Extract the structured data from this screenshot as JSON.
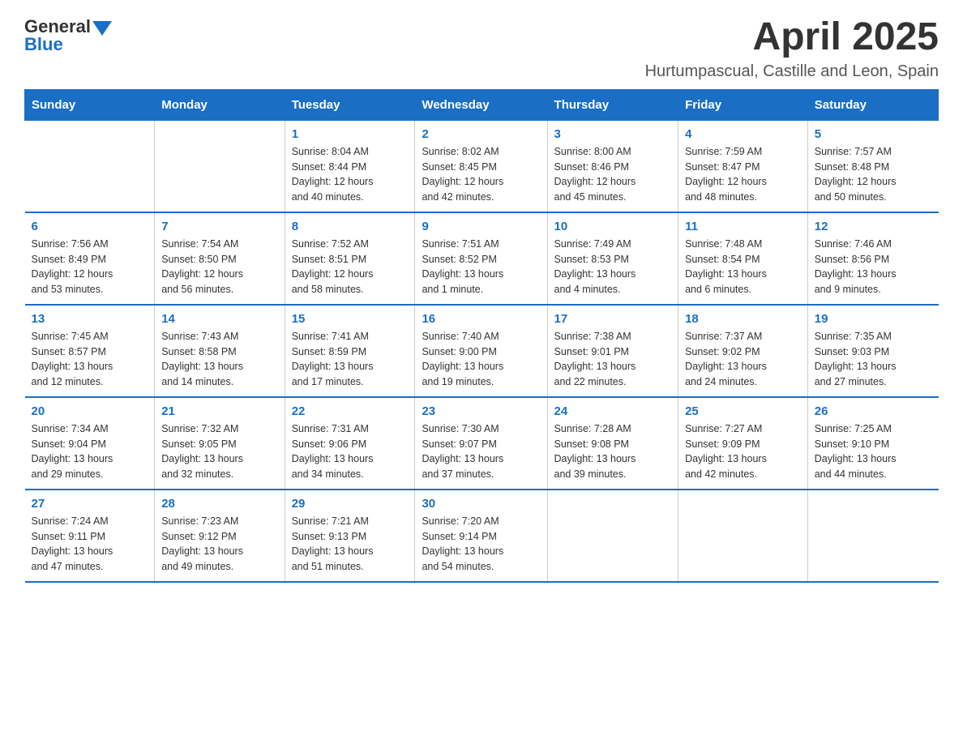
{
  "logo": {
    "text_general": "General",
    "text_blue": "Blue"
  },
  "header": {
    "month_year": "April 2025",
    "location": "Hurtumpascual, Castille and Leon, Spain"
  },
  "days_of_week": [
    "Sunday",
    "Monday",
    "Tuesday",
    "Wednesday",
    "Thursday",
    "Friday",
    "Saturday"
  ],
  "weeks": [
    [
      {
        "day": "",
        "info": ""
      },
      {
        "day": "",
        "info": ""
      },
      {
        "day": "1",
        "info": "Sunrise: 8:04 AM\nSunset: 8:44 PM\nDaylight: 12 hours\nand 40 minutes."
      },
      {
        "day": "2",
        "info": "Sunrise: 8:02 AM\nSunset: 8:45 PM\nDaylight: 12 hours\nand 42 minutes."
      },
      {
        "day": "3",
        "info": "Sunrise: 8:00 AM\nSunset: 8:46 PM\nDaylight: 12 hours\nand 45 minutes."
      },
      {
        "day": "4",
        "info": "Sunrise: 7:59 AM\nSunset: 8:47 PM\nDaylight: 12 hours\nand 48 minutes."
      },
      {
        "day": "5",
        "info": "Sunrise: 7:57 AM\nSunset: 8:48 PM\nDaylight: 12 hours\nand 50 minutes."
      }
    ],
    [
      {
        "day": "6",
        "info": "Sunrise: 7:56 AM\nSunset: 8:49 PM\nDaylight: 12 hours\nand 53 minutes."
      },
      {
        "day": "7",
        "info": "Sunrise: 7:54 AM\nSunset: 8:50 PM\nDaylight: 12 hours\nand 56 minutes."
      },
      {
        "day": "8",
        "info": "Sunrise: 7:52 AM\nSunset: 8:51 PM\nDaylight: 12 hours\nand 58 minutes."
      },
      {
        "day": "9",
        "info": "Sunrise: 7:51 AM\nSunset: 8:52 PM\nDaylight: 13 hours\nand 1 minute."
      },
      {
        "day": "10",
        "info": "Sunrise: 7:49 AM\nSunset: 8:53 PM\nDaylight: 13 hours\nand 4 minutes."
      },
      {
        "day": "11",
        "info": "Sunrise: 7:48 AM\nSunset: 8:54 PM\nDaylight: 13 hours\nand 6 minutes."
      },
      {
        "day": "12",
        "info": "Sunrise: 7:46 AM\nSunset: 8:56 PM\nDaylight: 13 hours\nand 9 minutes."
      }
    ],
    [
      {
        "day": "13",
        "info": "Sunrise: 7:45 AM\nSunset: 8:57 PM\nDaylight: 13 hours\nand 12 minutes."
      },
      {
        "day": "14",
        "info": "Sunrise: 7:43 AM\nSunset: 8:58 PM\nDaylight: 13 hours\nand 14 minutes."
      },
      {
        "day": "15",
        "info": "Sunrise: 7:41 AM\nSunset: 8:59 PM\nDaylight: 13 hours\nand 17 minutes."
      },
      {
        "day": "16",
        "info": "Sunrise: 7:40 AM\nSunset: 9:00 PM\nDaylight: 13 hours\nand 19 minutes."
      },
      {
        "day": "17",
        "info": "Sunrise: 7:38 AM\nSunset: 9:01 PM\nDaylight: 13 hours\nand 22 minutes."
      },
      {
        "day": "18",
        "info": "Sunrise: 7:37 AM\nSunset: 9:02 PM\nDaylight: 13 hours\nand 24 minutes."
      },
      {
        "day": "19",
        "info": "Sunrise: 7:35 AM\nSunset: 9:03 PM\nDaylight: 13 hours\nand 27 minutes."
      }
    ],
    [
      {
        "day": "20",
        "info": "Sunrise: 7:34 AM\nSunset: 9:04 PM\nDaylight: 13 hours\nand 29 minutes."
      },
      {
        "day": "21",
        "info": "Sunrise: 7:32 AM\nSunset: 9:05 PM\nDaylight: 13 hours\nand 32 minutes."
      },
      {
        "day": "22",
        "info": "Sunrise: 7:31 AM\nSunset: 9:06 PM\nDaylight: 13 hours\nand 34 minutes."
      },
      {
        "day": "23",
        "info": "Sunrise: 7:30 AM\nSunset: 9:07 PM\nDaylight: 13 hours\nand 37 minutes."
      },
      {
        "day": "24",
        "info": "Sunrise: 7:28 AM\nSunset: 9:08 PM\nDaylight: 13 hours\nand 39 minutes."
      },
      {
        "day": "25",
        "info": "Sunrise: 7:27 AM\nSunset: 9:09 PM\nDaylight: 13 hours\nand 42 minutes."
      },
      {
        "day": "26",
        "info": "Sunrise: 7:25 AM\nSunset: 9:10 PM\nDaylight: 13 hours\nand 44 minutes."
      }
    ],
    [
      {
        "day": "27",
        "info": "Sunrise: 7:24 AM\nSunset: 9:11 PM\nDaylight: 13 hours\nand 47 minutes."
      },
      {
        "day": "28",
        "info": "Sunrise: 7:23 AM\nSunset: 9:12 PM\nDaylight: 13 hours\nand 49 minutes."
      },
      {
        "day": "29",
        "info": "Sunrise: 7:21 AM\nSunset: 9:13 PM\nDaylight: 13 hours\nand 51 minutes."
      },
      {
        "day": "30",
        "info": "Sunrise: 7:20 AM\nSunset: 9:14 PM\nDaylight: 13 hours\nand 54 minutes."
      },
      {
        "day": "",
        "info": ""
      },
      {
        "day": "",
        "info": ""
      },
      {
        "day": "",
        "info": ""
      }
    ]
  ]
}
